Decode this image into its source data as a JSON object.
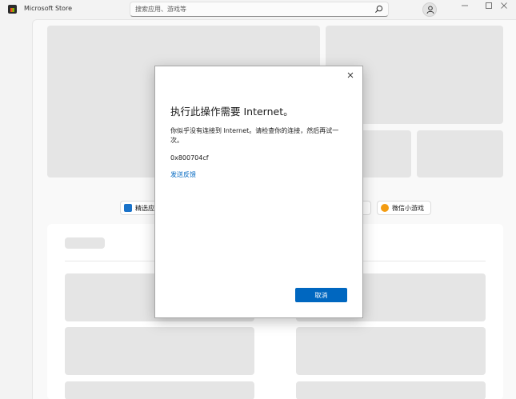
{
  "window": {
    "title": "Microsoft Store"
  },
  "search": {
    "placeholder": "搜索应用、游戏等"
  },
  "chips": [
    {
      "label": "精选应",
      "icon": "star-icon"
    },
    {
      "label": "微信小游戏",
      "icon": "game-icon"
    }
  ],
  "dialog": {
    "title": "执行此操作需要 Internet。",
    "message": "你似乎没有连接到 Internet。请检查你的连接，然后再试一次。",
    "code": "0x800704cf",
    "link": "发送反馈",
    "button": "取消"
  },
  "colors": {
    "accent": "#0067c0",
    "placeholder": "#e5e5e5"
  }
}
